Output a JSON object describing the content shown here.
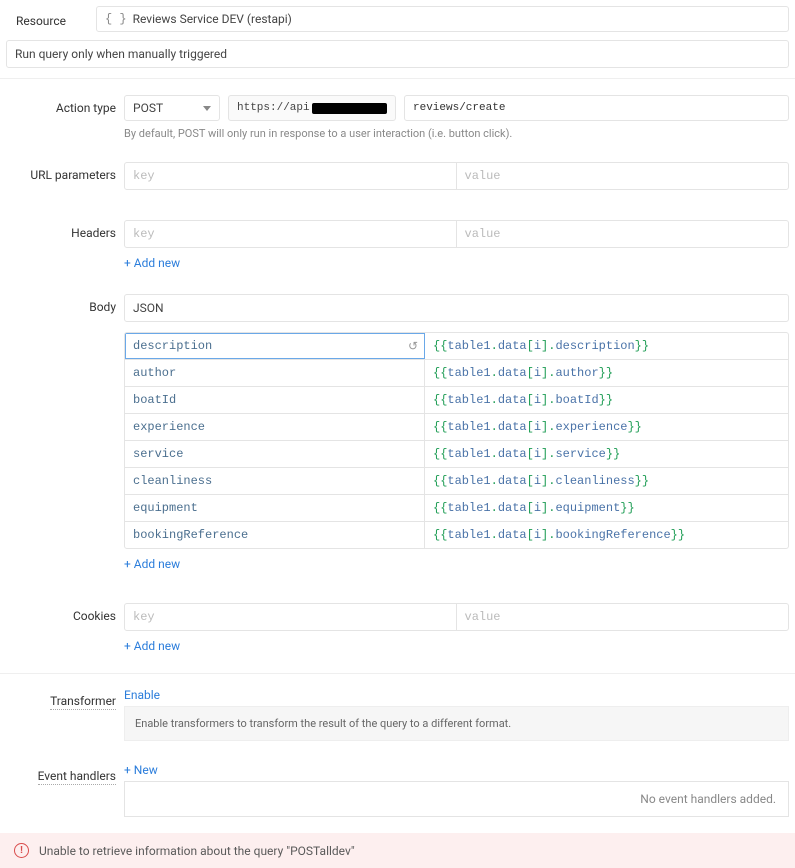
{
  "resource": {
    "label": "Resource",
    "icon_text": "{ }",
    "value": "Reviews Service DEV (restapi)"
  },
  "trigger": {
    "text": "Run query only when manually triggered"
  },
  "action": {
    "label": "Action type",
    "method": "POST",
    "url_prefix_visible": "https://api",
    "url_suffix": "reviews/create",
    "hint": "By default, POST will only run in response to a user interaction (i.e. button click)."
  },
  "url_params": {
    "label": "URL parameters",
    "key_placeholder": "key",
    "val_placeholder": "value"
  },
  "headers": {
    "label": "Headers",
    "key_placeholder": "key",
    "val_placeholder": "value"
  },
  "body": {
    "label": "Body",
    "type": "JSON",
    "rows": [
      {
        "key": "description",
        "val": "{{table1.data[i].description}}"
      },
      {
        "key": "author",
        "val": "{{table1.data[i].author}}"
      },
      {
        "key": "boatId",
        "val": "{{table1.data[i].boatId}}"
      },
      {
        "key": "experience",
        "val": "{{table1.data[i].experience}}"
      },
      {
        "key": "service",
        "val": "{{table1.data[i].service}}"
      },
      {
        "key": "cleanliness",
        "val": "{{table1.data[i].cleanliness}}"
      },
      {
        "key": "equipment",
        "val": "{{table1.data[i].equipment}}"
      },
      {
        "key": "bookingReference",
        "val": "{{table1.data[i].bookingReference}}"
      }
    ]
  },
  "cookies": {
    "label": "Cookies",
    "key_placeholder": "key",
    "val_placeholder": "value"
  },
  "transformer": {
    "label": "Transformer",
    "link": "Enable",
    "desc": "Enable transformers to transform the result of the query to a different format."
  },
  "event_handlers": {
    "label": "Event handlers",
    "link": "+ New",
    "empty": "No event handlers added."
  },
  "add_new": "+ Add new",
  "error": {
    "message": "Unable to retrieve information about the query \"POSTalldev\""
  }
}
